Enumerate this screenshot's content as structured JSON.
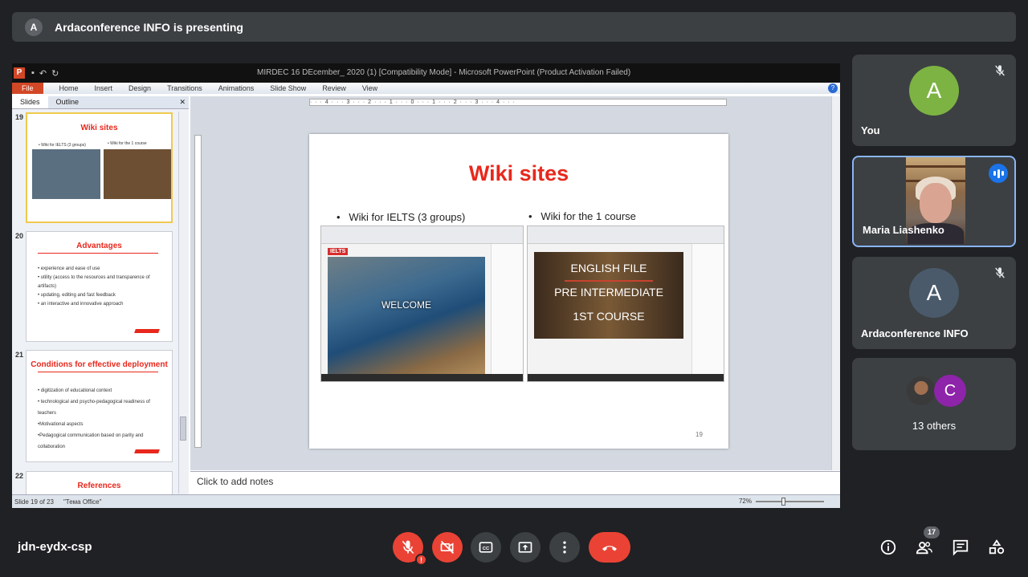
{
  "banner": {
    "avatar": "A",
    "text": "Ardaconference INFO is presenting"
  },
  "ppt": {
    "window_title": "MIRDEC 16 DEcember_ 2020 (1) [Compatibility Mode] - Microsoft PowerPoint (Product Activation Failed)",
    "ribbon_tabs": [
      "File",
      "Home",
      "Insert",
      "Design",
      "Transitions",
      "Animations",
      "Slide Show",
      "Review",
      "View"
    ],
    "panel_tabs": [
      "Slides",
      "Outline"
    ],
    "thumbs": [
      {
        "num": "19",
        "title": "Wiki sites",
        "bullets": [
          "• Wiki for IELTS (3 groups)",
          "• Wiki for the 1 course"
        ]
      },
      {
        "num": "20",
        "title": "Advantages",
        "bullets": [
          "• experience and ease of use",
          "• utility (access to the resources and transparence of",
          "artifacts)",
          "• updating, editing and fast feedback",
          "• an interactive and innovative approach"
        ]
      },
      {
        "num": "21",
        "title": "Conditions for effective deployment",
        "bullets": [
          "• digitization of educational context",
          "• technological and psycho-pedagogical readiness of",
          "teachers",
          "•Motivational aspects",
          "•Pedagogical communication based on parity and",
          "collaboration"
        ]
      },
      {
        "num": "22",
        "title": "References",
        "bullets": []
      }
    ],
    "slide": {
      "title": "Wiki sites",
      "bullet_left": "Wiki for IELTS (3 groups)",
      "bullet_right": "Wiki for the 1 course",
      "page_number": "19",
      "shot_left": {
        "badge": "IELTS",
        "hero": "WELCOME"
      },
      "shot_right": {
        "lines": [
          "ENGLISH FILE",
          "PRE INTERMEDIATE",
          "1ST COURSE"
        ]
      }
    },
    "notes_placeholder": "Click to add notes",
    "status": {
      "slide": "Slide 19 of 23",
      "theme": "\"Тема Office\"",
      "zoom": "72%"
    }
  },
  "participants": [
    {
      "name": "You",
      "avatar": "A",
      "color": "#7cb342",
      "muted": true
    },
    {
      "name": "Maria Liashenko",
      "speaking": true
    },
    {
      "name": "Ardaconference INFO",
      "avatar": "A",
      "color": "#4a5a6a",
      "muted": true
    },
    {
      "name": "13 others",
      "avatar": "C",
      "color": "#8e24aa"
    }
  ],
  "meeting": {
    "code": "jdn-eydx-csp",
    "participant_count": "17"
  }
}
